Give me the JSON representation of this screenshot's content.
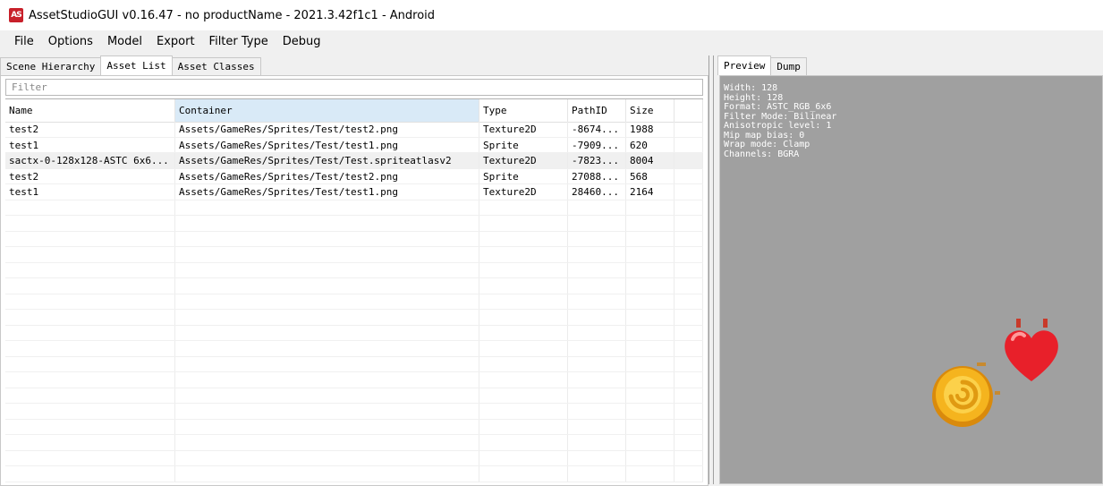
{
  "window": {
    "title": "AssetStudioGUI v0.16.47 - no productName - 2021.3.42f1c1 - Android",
    "icon_text": "AS"
  },
  "menu": [
    "File",
    "Options",
    "Model",
    "Export",
    "Filter Type",
    "Debug"
  ],
  "left_tabs": [
    {
      "label": "Scene Hierarchy",
      "active": false
    },
    {
      "label": "Asset List",
      "active": true
    },
    {
      "label": "Asset Classes",
      "active": false
    }
  ],
  "filter": {
    "placeholder": "Filter"
  },
  "table": {
    "columns": [
      "Name",
      "Container",
      "Type",
      "PathID",
      "Size"
    ],
    "rows": [
      {
        "name": "test2",
        "container": "Assets/GameRes/Sprites/Test/test2.png",
        "type": "Texture2D",
        "pathid": "-8674...",
        "size": "1988"
      },
      {
        "name": "test1",
        "container": "Assets/GameRes/Sprites/Test/test1.png",
        "type": "Sprite",
        "pathid": "-7909...",
        "size": "620"
      },
      {
        "name": "sactx-0-128x128-ASTC 6x6...",
        "container": "Assets/GameRes/Sprites/Test/Test.spriteatlasv2",
        "type": "Texture2D",
        "pathid": "-7823...",
        "size": "8004"
      },
      {
        "name": "test2",
        "container": "Assets/GameRes/Sprites/Test/test2.png",
        "type": "Sprite",
        "pathid": "27088...",
        "size": "568"
      },
      {
        "name": "test1",
        "container": "Assets/GameRes/Sprites/Test/test1.png",
        "type": "Texture2D",
        "pathid": "28460...",
        "size": "2164"
      }
    ]
  },
  "right_tabs": [
    {
      "label": "Preview",
      "active": true
    },
    {
      "label": "Dump",
      "active": false
    }
  ],
  "preview": {
    "info": [
      "Width: 128",
      "Height: 128",
      "Format: ASTC_RGB_6x6",
      "Filter Mode: Bilinear",
      "Anisotropic level: 1",
      "Mip map bias: 0",
      "Wrap mode: Clamp",
      "Channels: BGRA"
    ],
    "background": "#a0a0a0"
  }
}
